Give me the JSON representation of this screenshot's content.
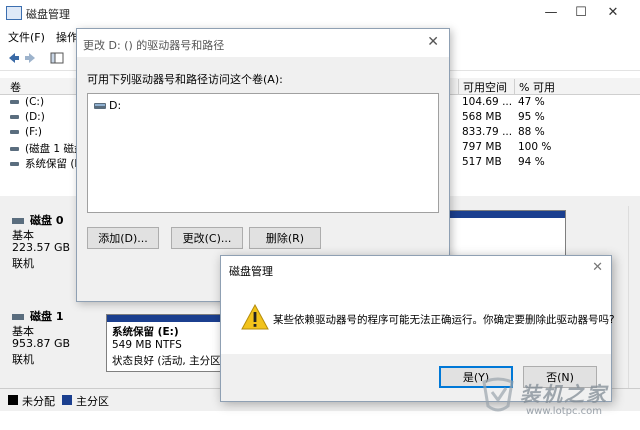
{
  "main": {
    "title": "磁盘管理",
    "win_min": "—",
    "win_max": "☐",
    "win_close": "✕",
    "menu": [
      "文件(F)",
      "操作"
    ]
  },
  "volumes": {
    "headers": [
      "卷",
      "可用空间",
      "% 可用"
    ],
    "rows": [
      {
        "name": "(C:)",
        "free": "104.69 ...",
        "pct": "47 %"
      },
      {
        "name": "(D:)",
        "free": "568 MB",
        "pct": "95 %"
      },
      {
        "name": "(F:)",
        "free": "833.79 ...",
        "pct": "88 %"
      },
      {
        "name": "(磁盘 1 磁盘",
        "free": "797 MB",
        "pct": "100 %"
      },
      {
        "name": "系统保留 (E",
        "free": "517 MB",
        "pct": "94 %"
      }
    ]
  },
  "disks": [
    {
      "name": "磁盘 0",
      "type": "基本",
      "size": "223.57 GB",
      "status": "联机"
    },
    {
      "name": "磁盘 1",
      "type": "基本",
      "size": "953.87 GB",
      "status": "联机"
    }
  ],
  "partition_e": {
    "name": "系统保留  (E:)",
    "size": "549 MB NTFS",
    "status": "状态良好 (活动, 主分区)"
  },
  "legend": [
    {
      "label": "未分配",
      "color": "#000000"
    },
    {
      "label": "主分区",
      "color": "#1b3f8f"
    }
  ],
  "change_dialog": {
    "title": "更改 D: () 的驱动器号和路径",
    "close": "✕",
    "description": "可用下列驱动器号和路径访问这个卷(A):",
    "list_items": [
      "D:"
    ],
    "add_label": "添加(D)...",
    "change_label": "更改(C)...",
    "delete_label": "删除(R)"
  },
  "confirm_dialog": {
    "title": "磁盘管理",
    "close": "✕",
    "message": "某些依赖驱动器号的程序可能无法正确运行。你确定要删除此驱动器号吗?",
    "yes_label": "是(Y)",
    "no_label": "否(N)"
  },
  "watermark": {
    "text": "装机之家",
    "url": "www.lotpc.com"
  },
  "colors": {
    "primary_partition": "#1b3f8f",
    "unallocated": "#000000",
    "button_focus": "#0078d7"
  }
}
